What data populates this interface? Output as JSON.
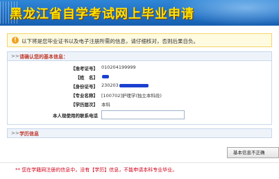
{
  "header": {
    "title": "黑龙江省自学考试网上毕业申请"
  },
  "notice": {
    "icon": "info-icon",
    "text": "以下将是您毕业证书以及电子注册所需的信息，请仔细核对，否则后果自负。"
  },
  "section_basic": {
    "arrows": ">>",
    "title": "请确认您的基本信息：",
    "fields": [
      {
        "label": "【准考证号】",
        "value": "010204199999"
      },
      {
        "label": "【姓　名】",
        "value": ""
      },
      {
        "label": "【身份证号】",
        "value": "230203"
      },
      {
        "label": "【专业名称】",
        "value": "[100702]护理学(独立本科段)"
      },
      {
        "label": "【学历层次】",
        "value": "本科"
      }
    ],
    "phone_label": "本人现使用的联系电话",
    "phone_value": ""
  },
  "section_edu": {
    "arrows": ">>",
    "title": "学历信息"
  },
  "button": {
    "label": "基本信息不正确"
  },
  "footer_note": "** 您在学籍网注册的信息中，没有【学历】信息，不能申请本科专业毕业。",
  "colors": {
    "header_bg": "#1f6fc4",
    "title_color": "#ffe200",
    "accent_red": "#c0392b",
    "redact_blue": "#1b3fd0"
  }
}
